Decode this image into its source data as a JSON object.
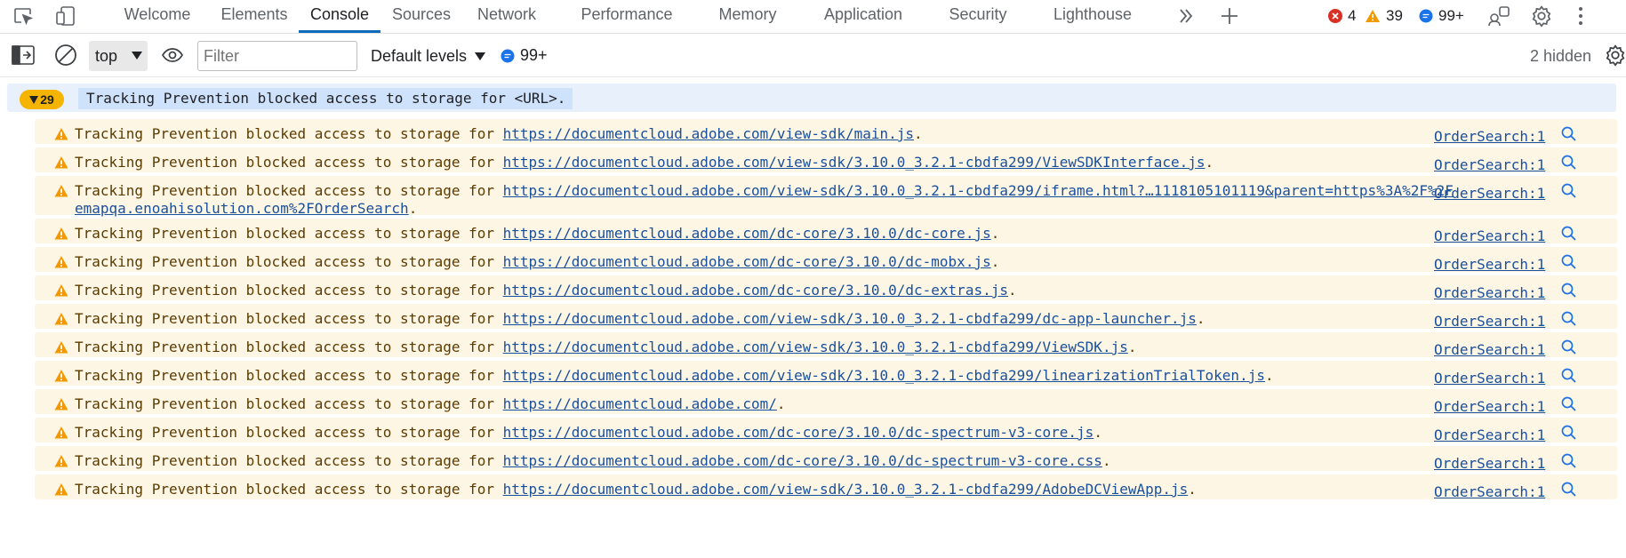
{
  "tabbar": {
    "tabs": [
      {
        "label": "Welcome",
        "active": false
      },
      {
        "label": "Elements",
        "active": false
      },
      {
        "label": "Console",
        "active": true
      },
      {
        "label": "Sources",
        "active": false
      },
      {
        "label": "Network",
        "active": false
      },
      {
        "label": "Performance",
        "active": false
      },
      {
        "label": "Memory",
        "active": false
      },
      {
        "label": "Application",
        "active": false
      },
      {
        "label": "Security",
        "active": false
      },
      {
        "label": "Lighthouse",
        "active": false
      }
    ],
    "errors": "4",
    "warnings": "39",
    "messages": "99+",
    "icons": [
      "inspect-icon",
      "device-toolbar-icon",
      "more-tabs-icon",
      "add-tab-icon",
      "customize-icon",
      "settings-icon",
      "more-options-icon"
    ],
    "colors": {
      "error": "#d93025",
      "warning": "#f29900",
      "info": "#1a73e8",
      "active_tab": "#0f6cbd"
    }
  },
  "toolbar": {
    "context": "top",
    "filter_placeholder": "Filter",
    "levels": "Default levels",
    "message_count": "99+",
    "hidden": "2 hidden"
  },
  "console": {
    "group": {
      "count": "29",
      "text": "Tracking Prevention blocked access to storage for <URL>."
    },
    "messages": [
      {
        "prefix": "Tracking Prevention blocked access to storage for ",
        "url": "https://documentcloud.adobe.com/view-sdk/main.js",
        "suffix": ".",
        "source": "OrderSearch:1"
      },
      {
        "prefix": "Tracking Prevention blocked access to storage for ",
        "url": "https://documentcloud.adobe.com/view-sdk/3.10.0_3.2.1-cbdfa299/ViewSDKInterface.js",
        "suffix": ".",
        "source": "OrderSearch:1"
      },
      {
        "prefix": "Tracking Prevention blocked access to storage for ",
        "url": "https://documentcloud.adobe.com/view-sdk/3.10.0_3.2.1-cbdfa299/iframe.html?…1118105101119&parent=https%3A%2F%2Femapqa.enoahisolution.com%2FOrderSearch",
        "suffix": ".",
        "source": "OrderSearch:1"
      },
      {
        "prefix": "Tracking Prevention blocked access to storage for ",
        "url": "https://documentcloud.adobe.com/dc-core/3.10.0/dc-core.js",
        "suffix": ".",
        "source": "OrderSearch:1"
      },
      {
        "prefix": "Tracking Prevention blocked access to storage for ",
        "url": "https://documentcloud.adobe.com/dc-core/3.10.0/dc-mobx.js",
        "suffix": ".",
        "source": "OrderSearch:1"
      },
      {
        "prefix": "Tracking Prevention blocked access to storage for ",
        "url": "https://documentcloud.adobe.com/dc-core/3.10.0/dc-extras.js",
        "suffix": ".",
        "source": "OrderSearch:1"
      },
      {
        "prefix": "Tracking Prevention blocked access to storage for ",
        "url": "https://documentcloud.adobe.com/view-sdk/3.10.0_3.2.1-cbdfa299/dc-app-launcher.js",
        "suffix": ".",
        "source": "OrderSearch:1"
      },
      {
        "prefix": "Tracking Prevention blocked access to storage for ",
        "url": "https://documentcloud.adobe.com/view-sdk/3.10.0_3.2.1-cbdfa299/ViewSDK.js",
        "suffix": ".",
        "source": "OrderSearch:1"
      },
      {
        "prefix": "Tracking Prevention blocked access to storage for ",
        "url": "https://documentcloud.adobe.com/view-sdk/3.10.0_3.2.1-cbdfa299/linearizationTrialToken.js",
        "suffix": ".",
        "source": "OrderSearch:1"
      },
      {
        "prefix": "Tracking Prevention blocked access to storage for ",
        "url": "https://documentcloud.adobe.com/",
        "suffix": ".",
        "source": "OrderSearch:1"
      },
      {
        "prefix": "Tracking Prevention blocked access to storage for ",
        "url": "https://documentcloud.adobe.com/dc-core/3.10.0/dc-spectrum-v3-core.js",
        "suffix": ".",
        "source": "OrderSearch:1"
      },
      {
        "prefix": "Tracking Prevention blocked access to storage for ",
        "url": "https://documentcloud.adobe.com/dc-core/3.10.0/dc-spectrum-v3-core.css",
        "suffix": ".",
        "source": "OrderSearch:1"
      },
      {
        "prefix": "Tracking Prevention blocked access to storage for ",
        "url": "https://documentcloud.adobe.com/view-sdk/3.10.0_3.2.1-cbdfa299/AdobeDCViewApp.js",
        "suffix": ".",
        "source": "OrderSearch:1"
      }
    ]
  }
}
